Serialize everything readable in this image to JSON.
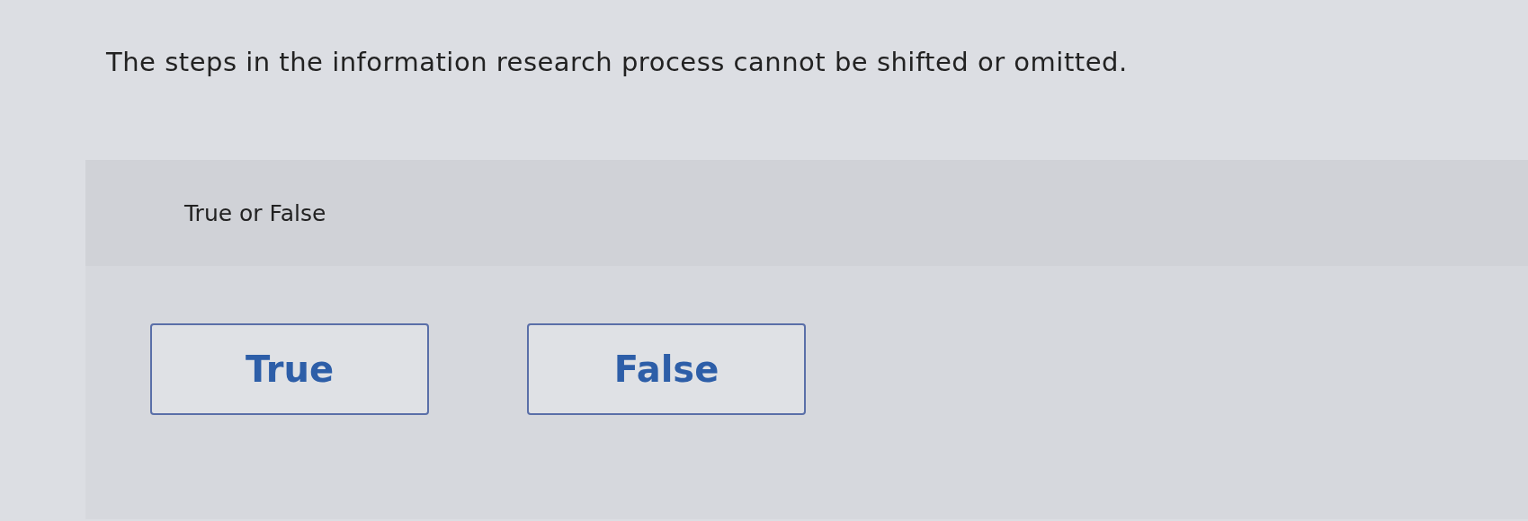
{
  "question": "The steps in the information research process cannot be shifted or omitted.",
  "instruction": "True or False",
  "options": [
    {
      "label": "True",
      "selected": false
    },
    {
      "label": "False",
      "selected": false
    }
  ]
}
